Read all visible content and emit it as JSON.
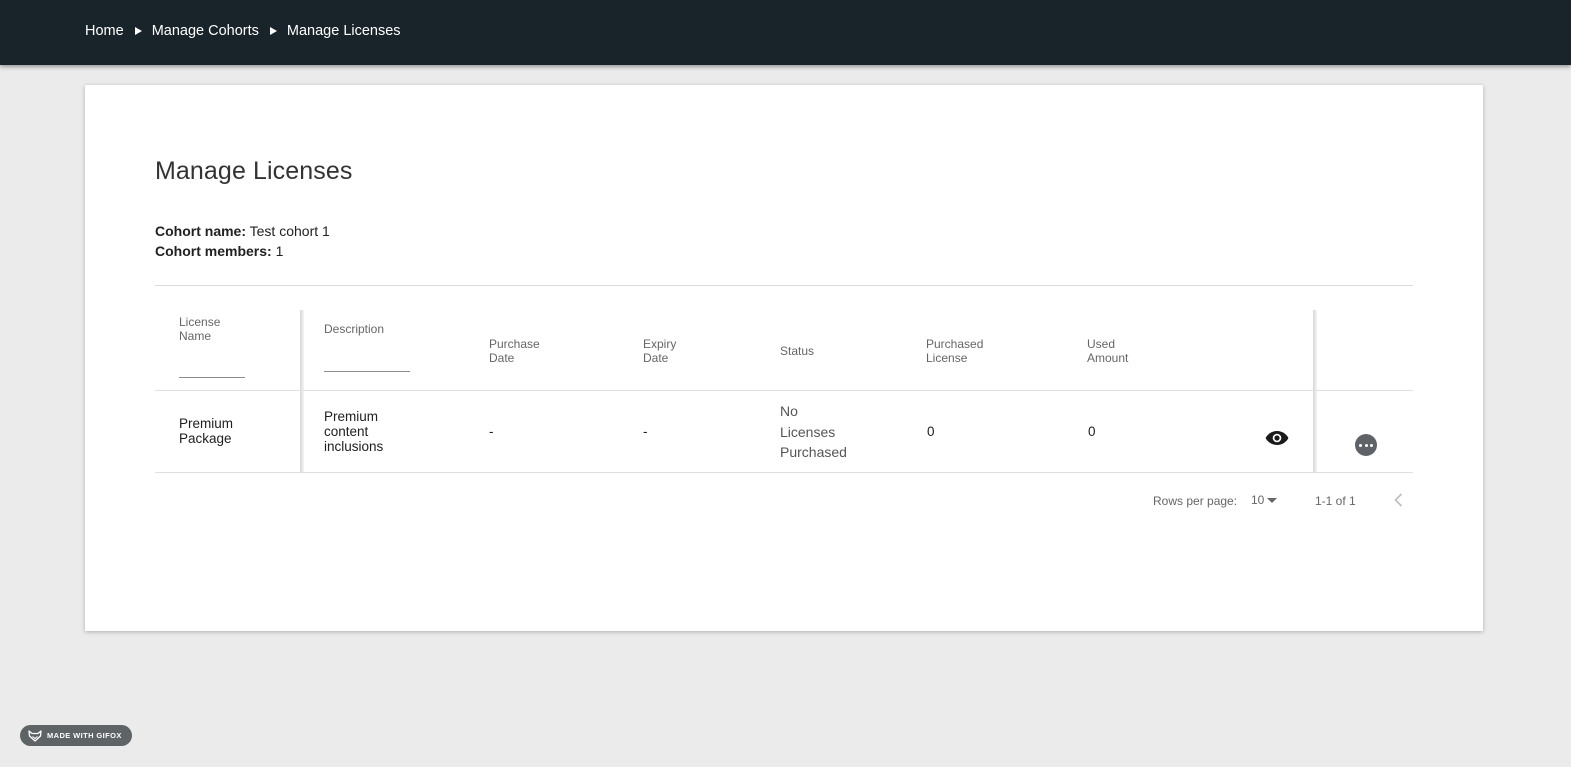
{
  "breadcrumb": {
    "items": [
      "Home",
      "Manage Cohorts",
      "Manage Licenses"
    ]
  },
  "page": {
    "title": "Manage Licenses",
    "cohort_name_label": "Cohort name:",
    "cohort_name_value": "Test cohort 1",
    "cohort_members_label": "Cohort members:",
    "cohort_members_value": "1"
  },
  "table": {
    "headers": {
      "license_name": [
        "License",
        "Name"
      ],
      "description": "Description",
      "purchase_date": [
        "Purchase",
        "Date"
      ],
      "expiry_date": [
        "Expiry",
        "Date"
      ],
      "status": "Status",
      "purchased_license": [
        "Purchased",
        "License"
      ],
      "used_amount": [
        "Used",
        "Amount"
      ]
    },
    "rows": [
      {
        "license_name": [
          "Premium",
          "Package"
        ],
        "description": [
          "Premium",
          "content",
          "inclusions"
        ],
        "purchase_date": "-",
        "expiry_date": "-",
        "status": [
          "No",
          "Licenses",
          "Purchased"
        ],
        "purchased_license": "0",
        "used_amount": "0"
      }
    ]
  },
  "pagination": {
    "rows_per_page_label": "Rows per page:",
    "rows_per_page_value": "10",
    "range": "1-1 of 1"
  },
  "badge": {
    "text": "MADE WITH GIFOX"
  },
  "colors": {
    "topbar": "#18232a",
    "background": "#ebebeb",
    "card": "#ffffff"
  },
  "icons": [
    "chevron-right-icon",
    "eye-icon",
    "more-horizontal-icon",
    "caret-down-icon",
    "chevron-left-icon",
    "fox-icon"
  ]
}
